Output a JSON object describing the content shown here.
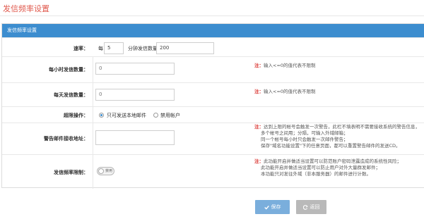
{
  "page": {
    "title": "发信频率设置"
  },
  "panel": {
    "header": "发信频率设置"
  },
  "rate": {
    "label": "速率：",
    "prefix": "每",
    "minutes_value": "5",
    "middle": "分钟发信数量",
    "count_value": "200"
  },
  "hourly": {
    "label": "每小时发信数量：",
    "value": "0",
    "note_star": "注：",
    "note": "输入<=0的值代表不限制"
  },
  "daily": {
    "label": "每天发信数量：",
    "value": "0",
    "note_star": "注：",
    "note": "输入<=0的值代表不限制"
  },
  "overlimit": {
    "label": "超限操作：",
    "options": [
      "只可发送本地邮件",
      "禁用帐户"
    ],
    "selected": "只可发送本地邮件"
  },
  "alert": {
    "label": "警告邮件接收地址：",
    "value": "",
    "note_star": "注：",
    "note_lines": [
      "达到上限的帐号会触发一次警告，此栏不填表明不需要接收系统的警告信息，",
      "多个帐号之间用；分隔，可输入外域邮箱；",
      "同一个帐号每小时只会触发一次邮件警告；",
      "保存\"域名功能设置\"下的任意页面，都可以重置警告邮件的发送CD。"
    ]
  },
  "limit": {
    "label": "发信频率限制：",
    "toggle_text": "禁用",
    "toggle_on": false,
    "note_star": "注：",
    "note_lines": [
      "此功能开启并做适当设置可以防范账户密码泄露造成的系统性风险；",
      "此功能开启并做适当设置可以防止用户对外大量群发邮件；",
      "本功能只对发往外域（非本服务器）的邮件进行计数。"
    ]
  },
  "buttons": {
    "save": "保存",
    "back": "返回"
  }
}
